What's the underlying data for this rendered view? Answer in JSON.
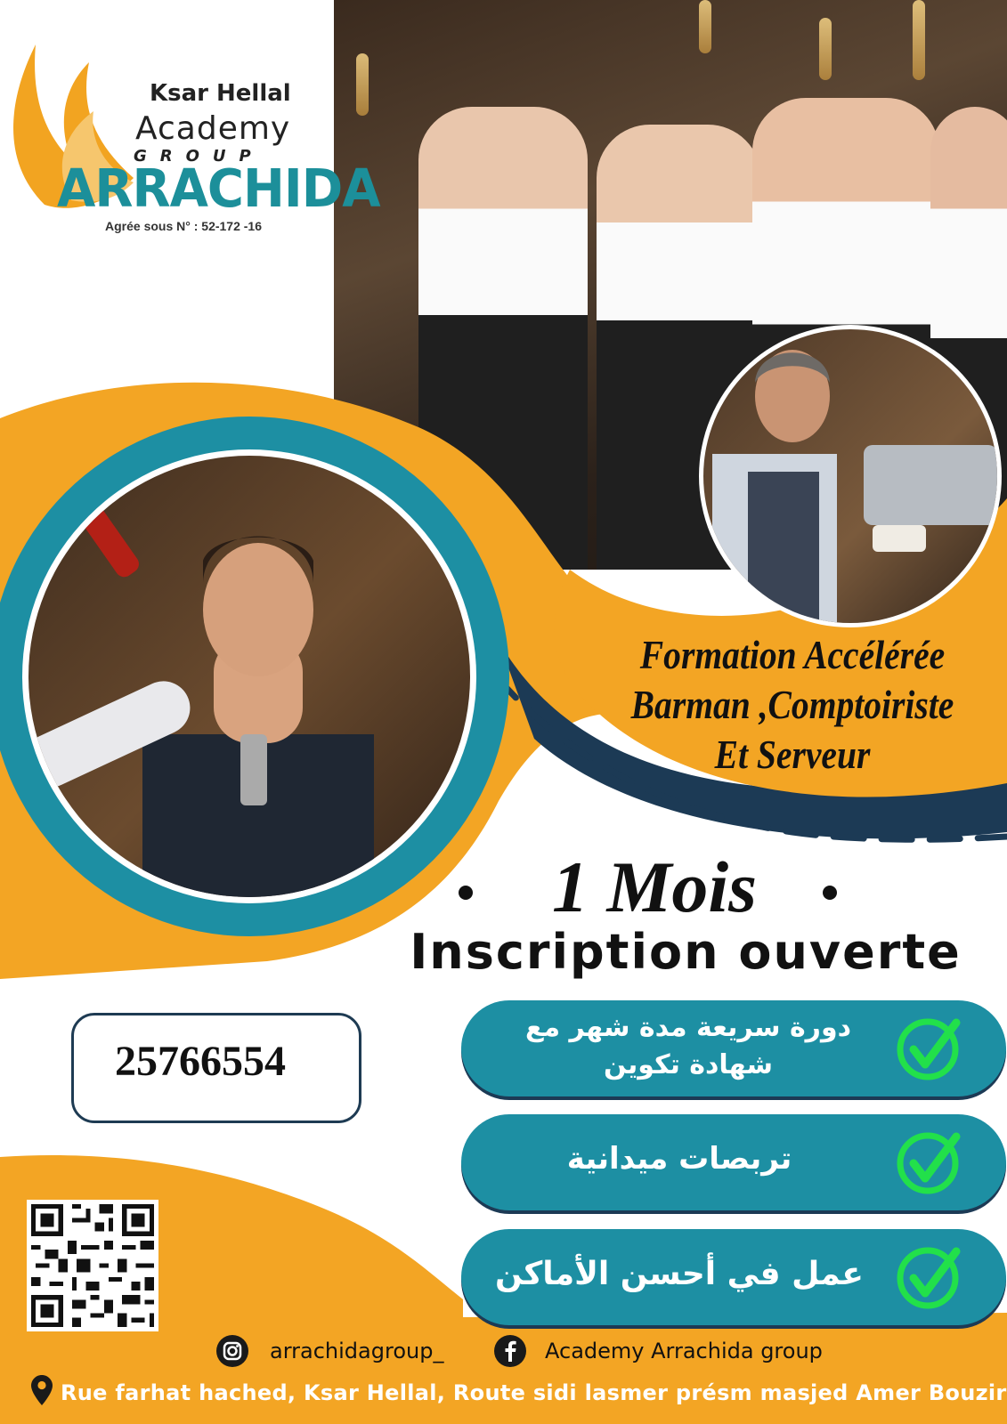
{
  "logo": {
    "line1": "Ksar Hellal",
    "line2": "Academy",
    "line3": "GROUP",
    "line4": "ARRACHIDA",
    "license": "Agrée sous N° : 52-172 -16"
  },
  "headline": {
    "line1": "Formation Accélérée",
    "line2": "Barman ,Comptoiriste",
    "line3": "Et Serveur"
  },
  "duration": "1 Mois",
  "registration": "Inscription ouverte",
  "phone": "25766554",
  "features": [
    {
      "line1": "دورة سريعة مدة شهر مع",
      "line2": "شهادة تكوين"
    },
    {
      "line1": "تربصات ميدانية"
    },
    {
      "line1": "عمل في أحسن الأماكن"
    }
  ],
  "social": {
    "instagram_icon": "instagram-icon",
    "instagram": "arrachidagroup_",
    "facebook_icon": "facebook-icon",
    "facebook": "Academy Arrachida group"
  },
  "address_icon": "location-pin-icon",
  "address": "Rue farhat hached, Ksar Hellal, Route sidi lasmer présm masjed Amer Bouzir",
  "colors": {
    "orange": "#f3a524",
    "teal": "#1d8fa3",
    "navy": "#1c3a55",
    "check_green": "#22e04a"
  }
}
